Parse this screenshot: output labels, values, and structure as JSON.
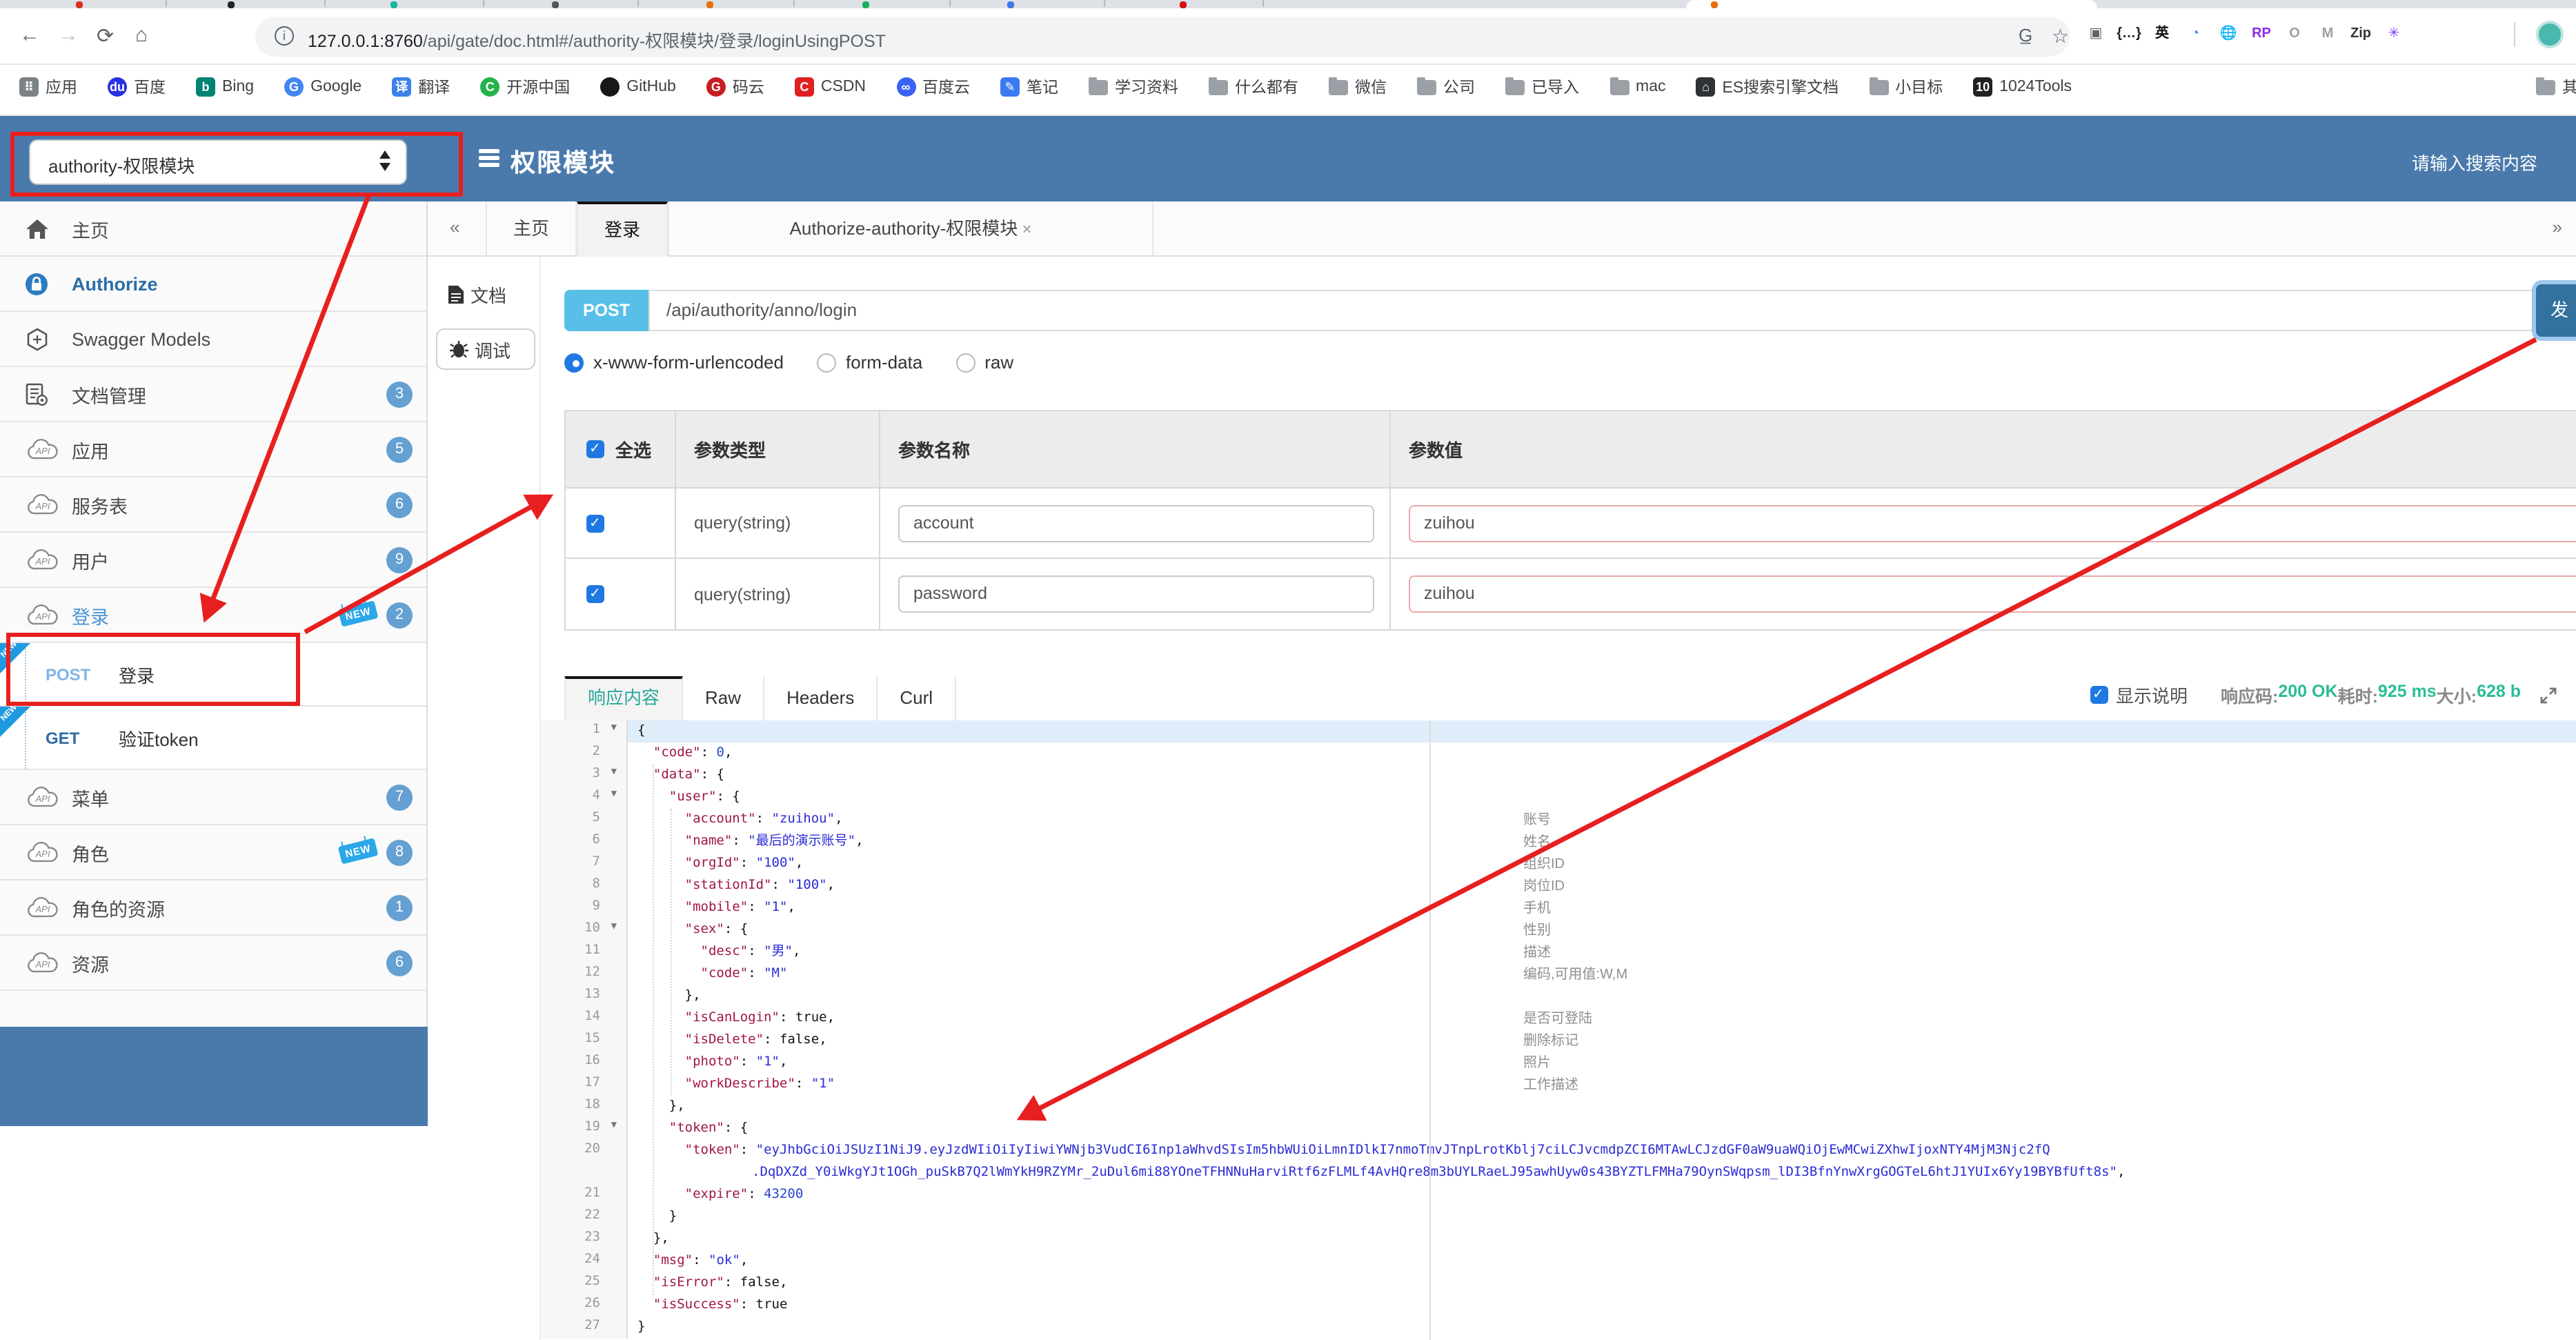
{
  "browser": {
    "tab_favicon_colors": [
      "#d93025",
      "#222222",
      "#16b8a0",
      "#555555",
      "#e8710a",
      "#1aad5c",
      "#3b78e7",
      "#d41111"
    ],
    "active_tab_favicon_color": "#e8710a",
    "toolbar": {
      "url_host": "127.0.0.1:8760",
      "url_path": "/api/gate/doc.html#/authority-权限模块/登录/loginUsingPOST"
    },
    "extensions": [
      {
        "glyph": "▣",
        "color": "#5f6368"
      },
      {
        "glyph": "{…}",
        "color": "#222"
      },
      {
        "glyph": "英",
        "color": "#111"
      },
      {
        "glyph": "◔",
        "color": "#4285f4"
      },
      {
        "glyph": "🌐",
        "color": "#2e7cd6"
      },
      {
        "glyph": "RP",
        "color": "#8a2be2"
      },
      {
        "glyph": "O",
        "color": "#9aa0a6"
      },
      {
        "glyph": "M",
        "color": "#9aa0a6"
      },
      {
        "glyph": "Zip",
        "color": "#333"
      },
      {
        "glyph": "✳",
        "color": "#7b3ff2"
      }
    ],
    "bookmarks": [
      {
        "label": "应用",
        "icon": "apps",
        "color": "#7d8286",
        "letter": "⠿"
      },
      {
        "label": "百度",
        "icon": "circ",
        "color": "#2932e1",
        "letter": "du"
      },
      {
        "label": "Bing",
        "icon": "sq",
        "color": "#008373",
        "letter": "b"
      },
      {
        "label": "Google",
        "icon": "circ",
        "color": "#4285f4",
        "letter": "G"
      },
      {
        "label": "翻译",
        "icon": "sq",
        "color": "#3b82e8",
        "letter": "译"
      },
      {
        "label": "开源中国",
        "icon": "circ",
        "color": "#24b34b",
        "letter": "C"
      },
      {
        "label": "GitHub",
        "icon": "circ",
        "color": "#191717",
        "letter": ""
      },
      {
        "label": "码云",
        "icon": "circ",
        "color": "#c71d23",
        "letter": "G"
      },
      {
        "label": "CSDN",
        "icon": "sq",
        "color": "#e02020",
        "letter": "C"
      },
      {
        "label": "百度云",
        "icon": "circ",
        "color": "#3a62f5",
        "letter": "∞"
      },
      {
        "label": "笔记",
        "icon": "sq",
        "color": "#3b7bf2",
        "letter": "✎"
      },
      {
        "label": "学习资料",
        "icon": "folder"
      },
      {
        "label": "什么都有",
        "icon": "folder"
      },
      {
        "label": "微信",
        "icon": "folder"
      },
      {
        "label": "公司",
        "icon": "folder"
      },
      {
        "label": "已导入",
        "icon": "folder"
      },
      {
        "label": "mac",
        "icon": "folder"
      },
      {
        "label": "ES搜索引擎文档",
        "icon": "sq",
        "color": "#2f3337",
        "letter": "⌂"
      },
      {
        "label": "小目标",
        "icon": "folder"
      },
      {
        "label": "1024Tools",
        "icon": "sq",
        "color": "#222",
        "letter": "10"
      }
    ],
    "bookmarks_overflow_label": "其"
  },
  "header": {
    "module_select_value": "authority-权限模块",
    "title": "权限模块",
    "search_placeholder": "请输入搜索内容"
  },
  "sidebar": {
    "items": [
      {
        "label": "主页",
        "icon": "home"
      },
      {
        "label": "Authorize",
        "icon": "lock",
        "selected": true
      },
      {
        "label": "Swagger Models",
        "icon": "hexagon"
      },
      {
        "label": "文档管理",
        "icon": "docgear",
        "badge": "3"
      },
      {
        "label": "应用",
        "icon": "cloudapi",
        "badge": "5"
      },
      {
        "label": "服务表",
        "icon": "cloudapi",
        "badge": "6"
      },
      {
        "label": "用户",
        "icon": "cloudapi",
        "badge": "9"
      },
      {
        "label": "登录",
        "icon": "cloudapi",
        "badge": "2",
        "new": true,
        "login": true
      },
      {
        "op": true,
        "method": "POST",
        "label": "登录",
        "new": true,
        "methodColor": "#7fb5e8"
      },
      {
        "op": true,
        "method": "GET",
        "label": "验证token",
        "new": true,
        "methodColor": "#2e6da4"
      },
      {
        "label": "菜单",
        "icon": "cloudapi",
        "badge": "7"
      },
      {
        "label": "角色",
        "icon": "cloudapi",
        "badge": "8",
        "new": true
      },
      {
        "label": "角色的资源",
        "icon": "cloudapi",
        "badge": "1"
      },
      {
        "label": "资源",
        "icon": "cloudapi",
        "badge": "6"
      }
    ]
  },
  "doc_tabs": {
    "collapse_left": "«",
    "collapse_right": "»",
    "tabs": [
      {
        "label": "主页"
      },
      {
        "label": "登录",
        "closable": true,
        "active": true
      },
      {
        "label": "Authorize-authority-权限模块",
        "closable": true
      }
    ]
  },
  "side_nav": [
    {
      "label": "文档",
      "icon": "doc"
    },
    {
      "label": "调试",
      "icon": "bug",
      "active": true
    }
  ],
  "debug": {
    "method": "POST",
    "url": "/api/authority/anno/login",
    "send_label": "发",
    "content_types": [
      {
        "label": "x-www-form-urlencoded",
        "selected": true
      },
      {
        "label": "form-data",
        "selected": false
      },
      {
        "label": "raw",
        "selected": false
      }
    ],
    "param_table": {
      "headers": [
        "全选",
        "参数类型",
        "参数名称",
        "参数值"
      ],
      "rows": [
        {
          "checked": true,
          "type": "query(string)",
          "name": "account",
          "value": "zuihou"
        },
        {
          "checked": true,
          "type": "query(string)",
          "name": "password",
          "value": "zuihou"
        }
      ]
    },
    "response_tabs": [
      {
        "label": "响应内容",
        "active": true
      },
      {
        "label": "Raw"
      },
      {
        "label": "Headers"
      },
      {
        "label": "Curl"
      }
    ],
    "show_desc_label": "显示说明",
    "meta": [
      {
        "label": "响应码:",
        "value": "200 OK"
      },
      {
        "label": "耗时:",
        "value": "925 ms"
      },
      {
        "label": "大小:",
        "value": "628 b"
      }
    ]
  },
  "code": {
    "lines": [
      {
        "n": 1,
        "fold": true,
        "active": true,
        "seg": [
          [
            "p",
            "{"
          ]
        ]
      },
      {
        "n": 2,
        "seg": [
          [
            "p",
            "  "
          ],
          [
            "k",
            "\"code\""
          ],
          [
            "p",
            ": "
          ],
          [
            "n",
            "0"
          ],
          [
            "p",
            ","
          ]
        ]
      },
      {
        "n": 3,
        "fold": true,
        "seg": [
          [
            "p",
            "  "
          ],
          [
            "k",
            "\"data\""
          ],
          [
            "p",
            ": {"
          ]
        ]
      },
      {
        "n": 4,
        "fold": true,
        "seg": [
          [
            "p",
            "    "
          ],
          [
            "k",
            "\"user\""
          ],
          [
            "p",
            ": {"
          ]
        ]
      },
      {
        "n": 5,
        "note": "账号",
        "seg": [
          [
            "p",
            "      "
          ],
          [
            "k",
            "\"account\""
          ],
          [
            "p",
            ": "
          ],
          [
            "s",
            "\"zuihou\""
          ],
          [
            "p",
            ","
          ]
        ]
      },
      {
        "n": 6,
        "note": "姓名",
        "seg": [
          [
            "p",
            "      "
          ],
          [
            "k",
            "\"name\""
          ],
          [
            "p",
            ": "
          ],
          [
            "s",
            "\"最后的演示账号\""
          ],
          [
            "p",
            ","
          ]
        ]
      },
      {
        "n": 7,
        "note": "组织ID",
        "seg": [
          [
            "p",
            "      "
          ],
          [
            "k",
            "\"orgId\""
          ],
          [
            "p",
            ": "
          ],
          [
            "s",
            "\"100\""
          ],
          [
            "p",
            ","
          ]
        ]
      },
      {
        "n": 8,
        "note": "岗位ID",
        "seg": [
          [
            "p",
            "      "
          ],
          [
            "k",
            "\"stationId\""
          ],
          [
            "p",
            ": "
          ],
          [
            "s",
            "\"100\""
          ],
          [
            "p",
            ","
          ]
        ]
      },
      {
        "n": 9,
        "note": "手机",
        "seg": [
          [
            "p",
            "      "
          ],
          [
            "k",
            "\"mobile\""
          ],
          [
            "p",
            ": "
          ],
          [
            "s",
            "\"1\""
          ],
          [
            "p",
            ","
          ]
        ]
      },
      {
        "n": 10,
        "fold": true,
        "note": "性别",
        "seg": [
          [
            "p",
            "      "
          ],
          [
            "k",
            "\"sex\""
          ],
          [
            "p",
            ": {"
          ]
        ]
      },
      {
        "n": 11,
        "note": "描述",
        "seg": [
          [
            "p",
            "        "
          ],
          [
            "k",
            "\"desc\""
          ],
          [
            "p",
            ": "
          ],
          [
            "s",
            "\"男\""
          ],
          [
            "p",
            ","
          ]
        ]
      },
      {
        "n": 12,
        "note": "编码,可用值:W,M",
        "seg": [
          [
            "p",
            "        "
          ],
          [
            "k",
            "\"code\""
          ],
          [
            "p",
            ": "
          ],
          [
            "s",
            "\"M\""
          ]
        ]
      },
      {
        "n": 13,
        "seg": [
          [
            "p",
            "      },"
          ]
        ]
      },
      {
        "n": 14,
        "note": "是否可登陆",
        "seg": [
          [
            "p",
            "      "
          ],
          [
            "k",
            "\"isCanLogin\""
          ],
          [
            "p",
            ": "
          ],
          [
            "b",
            "true"
          ],
          [
            "p",
            ","
          ]
        ]
      },
      {
        "n": 15,
        "note": "删除标记",
        "seg": [
          [
            "p",
            "      "
          ],
          [
            "k",
            "\"isDelete\""
          ],
          [
            "p",
            ": "
          ],
          [
            "b",
            "false"
          ],
          [
            "p",
            ","
          ]
        ]
      },
      {
        "n": 16,
        "note": "照片",
        "seg": [
          [
            "p",
            "      "
          ],
          [
            "k",
            "\"photo\""
          ],
          [
            "p",
            ": "
          ],
          [
            "s",
            "\"1\""
          ],
          [
            "p",
            ","
          ]
        ]
      },
      {
        "n": 17,
        "note": "工作描述",
        "seg": [
          [
            "p",
            "      "
          ],
          [
            "k",
            "\"workDescribe\""
          ],
          [
            "p",
            ": "
          ],
          [
            "s",
            "\"1\""
          ]
        ]
      },
      {
        "n": 18,
        "seg": [
          [
            "p",
            "    },"
          ]
        ]
      },
      {
        "n": 19,
        "fold": true,
        "seg": [
          [
            "p",
            "    "
          ],
          [
            "k",
            "\"token\""
          ],
          [
            "p",
            ": {"
          ]
        ]
      },
      {
        "n": 20,
        "seg": [
          [
            "p",
            "      "
          ],
          [
            "k",
            "\"token\""
          ],
          [
            "p",
            ": "
          ],
          [
            "s",
            "\"eyJhbGciOiJSUzI1NiJ9.eyJzdWIiOiIyIiwiYWNjb3VudCI6Inp1aWhvdSIsIm5hbWUiOiLmnIDlkI7nmoTmvJTnpLrotKblj7ciLCJvcmdpZCI6MTAwLCJzdGF0aW9uaWQiOjEwMCwiZXhwIjoxNTY4MjM3Njc2fQ"
          ]
        ]
      },
      {
        "wrap": true,
        "seg": [
          [
            "s",
            ".DqDXZd_Y0iWkgYJt1OGh_puSkB7Q2lWmYkH9RZYMr_2uDul6mi88YOneTFHNNuHarviRtf6zFLMLf4AvHQre8m3bUYLRaeLJ95awhUyw0s43BYZTLFMHa79OynSWqpsm_lDI3BfnYnwXrgGOGTeL6htJ1YUIx6Yy19BYBfUft8s\""
          ],
          [
            "p",
            ","
          ]
        ]
      },
      {
        "n": 21,
        "seg": [
          [
            "p",
            "      "
          ],
          [
            "k",
            "\"expire\""
          ],
          [
            "p",
            ": "
          ],
          [
            "n",
            "43200"
          ]
        ]
      },
      {
        "n": 22,
        "seg": [
          [
            "p",
            "    }"
          ]
        ]
      },
      {
        "n": 23,
        "seg": [
          [
            "p",
            "  },"
          ]
        ]
      },
      {
        "n": 24,
        "seg": [
          [
            "p",
            "  "
          ],
          [
            "k",
            "\"msg\""
          ],
          [
            "p",
            ": "
          ],
          [
            "s",
            "\"ok\""
          ],
          [
            "p",
            ","
          ]
        ]
      },
      {
        "n": 25,
        "seg": [
          [
            "p",
            "  "
          ],
          [
            "k",
            "\"isError\""
          ],
          [
            "p",
            ": "
          ],
          [
            "b",
            "false"
          ],
          [
            "p",
            ","
          ]
        ]
      },
      {
        "n": 26,
        "seg": [
          [
            "p",
            "  "
          ],
          [
            "k",
            "\"isSuccess\""
          ],
          [
            "p",
            ": "
          ],
          [
            "b",
            "true"
          ]
        ]
      },
      {
        "n": 27,
        "seg": [
          [
            "p",
            "}"
          ]
        ]
      }
    ]
  }
}
